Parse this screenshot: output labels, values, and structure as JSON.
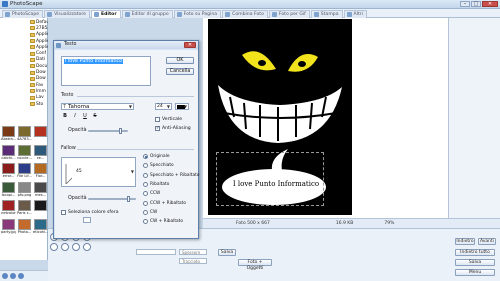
{
  "window": {
    "title": "PhotoScape",
    "minimize": "–",
    "maximize": "□",
    "close": "✕"
  },
  "tabs": [
    {
      "label": "PhotoScape",
      "active": false
    },
    {
      "label": "Visualizzatore",
      "active": false
    },
    {
      "label": "Editor",
      "active": true
    },
    {
      "label": "Editor di gruppo",
      "active": false
    },
    {
      "label": "Foto su Pagina",
      "active": false
    },
    {
      "label": "Combina Foto",
      "active": false
    },
    {
      "label": "Foto per Gif",
      "active": false
    },
    {
      "label": "Stampa",
      "active": false
    },
    {
      "label": "Altri",
      "active": false
    }
  ],
  "tree": [
    "Defaul",
    "27B5.tm",
    "Applicati",
    "Applicat",
    "Applicazi",
    "Conf",
    "Dati",
    "Docu",
    "Dow",
    "Dow",
    "Fav",
    "Imm",
    "Lav",
    "Sto"
  ],
  "thumbs": [
    {
      "label": "Abstra...",
      "color": "#7a3a16"
    },
    {
      "label": "4A763...",
      "color": "#7b6a2b"
    },
    {
      "label": "",
      "color": "#b4321f"
    },
    {
      "label": "catchi...",
      "color": "#5d2c78"
    },
    {
      "label": "cuccie...",
      "color": "#5c6e33"
    },
    {
      "label": "ce...",
      "color": "#2d5a7a"
    },
    {
      "label": "error...",
      "color": "#8a1c1c"
    },
    {
      "label": "File Lif...",
      "color": "#2c3d8a"
    },
    {
      "label": "Flor...",
      "color": "#b46a20"
    },
    {
      "label": "Iscopi...",
      "color": "#3a5a3a"
    },
    {
      "label": "pfo.png",
      "color": "#888888"
    },
    {
      "label": "mes...",
      "color": "#4a4a4a"
    },
    {
      "label": "netcolor",
      "color": "#a02222"
    },
    {
      "label": "Paris c...",
      "color": "#6a5a4a"
    },
    {
      "label": "",
      "color": "#1a1a1a"
    },
    {
      "label": "party.jpg",
      "color": "#8a3a7a"
    },
    {
      "label": "Photo...",
      "color": "#c46a2c"
    },
    {
      "label": "eticohi...",
      "color": "#2c6a8a"
    }
  ],
  "dialog": {
    "title": "Testo",
    "close": "✕",
    "text_value": "I love Punto Informatico",
    "ok": "OK",
    "cancel": "Cancella",
    "section_text": "Testo",
    "font": "Tahoma",
    "font_prefix": "T",
    "size": "24",
    "format_buttons": [
      "B",
      "I",
      "U",
      "S"
    ],
    "vertical_label": "Verticale",
    "vertical_checked": false,
    "antialias_label": "Anti-Aliasing",
    "antialias_checked": true,
    "opacity_label": "Opacità",
    "opacity_level": 0.8,
    "section_shadow": "Fallow",
    "shadow_angle": "45",
    "shadow_opacity_label": "Opacità",
    "shadow_opacity_level": 0.85,
    "select_color_label": "Seleziona colore sfera",
    "select_color_checked": false,
    "orientations": [
      {
        "label": "Originale",
        "selected": true
      },
      {
        "label": "Specchiato",
        "selected": false
      },
      {
        "label": "Specchiato + Ribaltato",
        "selected": false
      },
      {
        "label": "Ribaltato",
        "selected": false
      },
      {
        "label": "CCW",
        "selected": false
      },
      {
        "label": "CCW + Ribaltato",
        "selected": false
      },
      {
        "label": "CW",
        "selected": false
      },
      {
        "label": "CW + Ribaltato",
        "selected": false
      }
    ]
  },
  "canvas": {
    "bubble_text": "I love Punto Informatico"
  },
  "status": {
    "photo_size": "Foto 500 x 667",
    "file_size": "16.9 KB",
    "zoom": "79%"
  },
  "bottom": {
    "save_button": "Salva",
    "photo_objects_button": "Foto + Oggetti",
    "field1": "Spessore",
    "field2": "Tracciato",
    "undo_button": "Indietro",
    "redo_button": "Avanti",
    "undo_all_button": "Indietro tutto",
    "menu_button": "Menu"
  },
  "colors": {
    "accent": "#3399ff",
    "close": "#c9504a"
  }
}
